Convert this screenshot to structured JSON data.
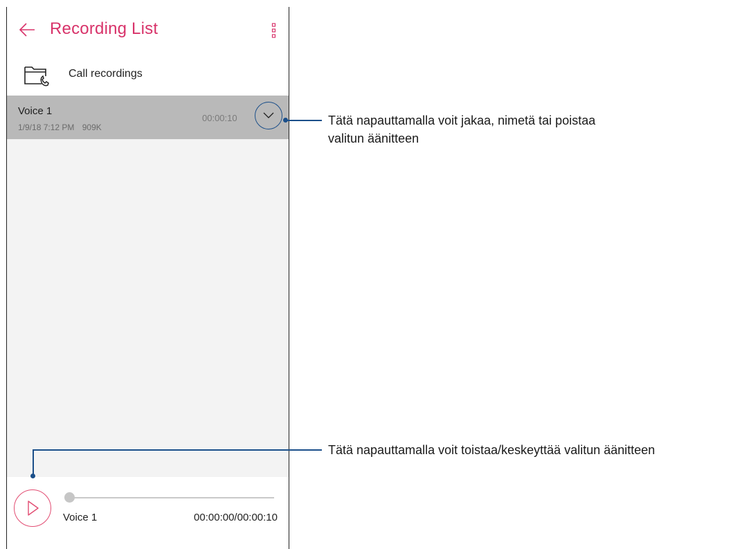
{
  "appbar": {
    "title": "Recording List",
    "back_icon": "arrow-left-icon",
    "menu_icon": "more-vertical-icon",
    "accent_color": "#d8336a"
  },
  "folder": {
    "label": "Call recordings",
    "icon": "folder-phone-icon"
  },
  "recordings": [
    {
      "name": "Voice 1",
      "datetime": "1/9/18 7:12 PM",
      "size": "909K",
      "duration": "00:00:10",
      "expand_icon": "chevron-down-icon"
    }
  ],
  "player": {
    "title": "Voice 1",
    "time": "00:00:00/00:00:10",
    "play_icon": "play-icon",
    "progress": 0
  },
  "callouts": {
    "expand": {
      "line1": "Tätä napauttamalla voit jakaa, nimetä tai poistaa",
      "line2": "valitun äänitteen"
    },
    "play": {
      "line1": "Tätä napauttamalla voit toistaa/keskeyttää valitun äänitteen"
    },
    "color": "#1b4f8a"
  }
}
